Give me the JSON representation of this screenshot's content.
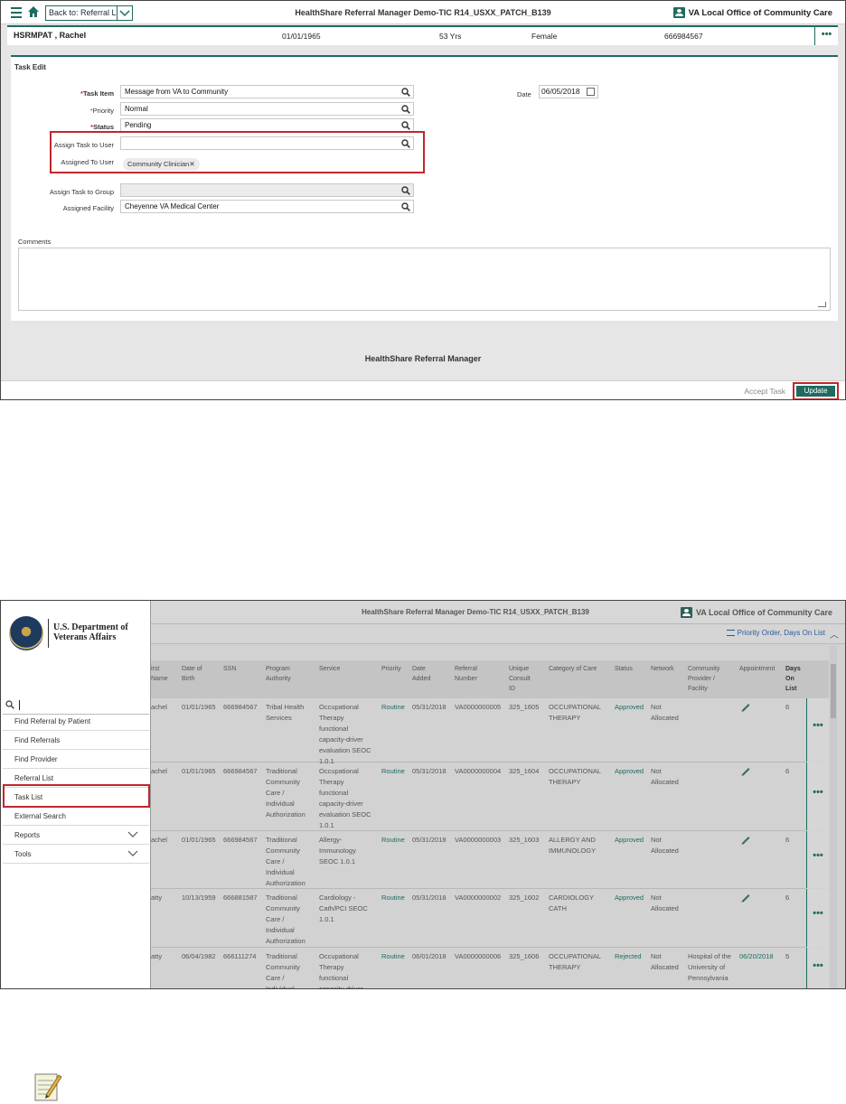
{
  "screen1": {
    "back_label": "Back to: Referral List",
    "app_title": "HealthShare Referral Manager Demo-TIC R14_USXX_PATCH_B139",
    "org_name": "VA Local Office of Community Care",
    "patient": {
      "name": "HSRMPAT , Rachel",
      "dob": "01/01/1965",
      "age": "53 Yrs",
      "gender": "Female",
      "ssn": "666984567"
    },
    "more_label": "•••",
    "form_title": "Task Edit",
    "fields": {
      "task_item": {
        "label": "Task Item",
        "value": "Message from VA to Community"
      },
      "priority": {
        "label": "Priority",
        "value": "Normal"
      },
      "status": {
        "label": "Status",
        "value": "Pending"
      },
      "assign_user": {
        "label": "Assign Task to User",
        "value": ""
      },
      "assigned_to_user": {
        "label": "Assigned To User",
        "chip": "Community Clinician",
        "chip_remove": "✕"
      },
      "assign_group": {
        "label": "Assign Task to Group",
        "value": ""
      },
      "assigned_facility": {
        "label": "Assigned Facility",
        "value": "Cheyenne VA Medical Center"
      },
      "date": {
        "label": "Date",
        "value": "06/05/2018"
      }
    },
    "required_marker": "*",
    "comments_label": "Comments",
    "footer_text": "HealthShare Referral Manager",
    "accept_task_label": "Accept Task",
    "update_label": "Update",
    "highlight_color": "#c0272d",
    "accent_color": "#1e6b5f"
  },
  "link_text": "",
  "screen2": {
    "app_title": "HealthShare Referral Manager Demo-TIC R14_USXX_PATCH_B139",
    "org_name": "VA Local Office of Community Care",
    "sort_label": "Priority Order, Days On List",
    "logo_text_line1": "U.S. Department of",
    "logo_text_line2": "Veterans Affairs",
    "menu": [
      {
        "label": "Find Referral by Patient"
      },
      {
        "label": "Find Referrals"
      },
      {
        "label": "Find Provider"
      },
      {
        "label": "Referral List"
      },
      {
        "label": "Task List"
      },
      {
        "label": "External Search"
      },
      {
        "label": "Reports"
      },
      {
        "label": "Tools"
      }
    ],
    "columns": [
      "irst\nName",
      "Date of\nBirth",
      "SSN",
      "Program\nAuthority",
      "Service",
      "Priority",
      "Date\nAdded",
      "Referral\nNumber",
      "Unique\nConsult\nID",
      "Category of Care",
      "Status",
      "Network",
      "Community\nProvider /\nFacility",
      "Appointment",
      "Days\nOn\nList"
    ],
    "rows": [
      {
        "first": "achel",
        "dob": "01/01/1965",
        "ssn": "666984567",
        "program": "Tribal Health\nServices",
        "service": "Occupational\nTherapy\nfunctional\ncapacity-driver\nevaluation SEOC\n1.0.1",
        "priority": "Routine",
        "added": "05/31/2018",
        "referral": "VA0000000005",
        "consult": "325_1605",
        "category": "OCCUPATIONAL\nTHERAPY",
        "status": "Approved",
        "network": "Not\nAllocated",
        "provider": "",
        "appointment": "",
        "days": "6"
      },
      {
        "first": "achel",
        "dob": "01/01/1965",
        "ssn": "666984567",
        "program": "Traditional\nCommunity\nCare /\nIndividual\nAuthorization",
        "service": "Occupational\nTherapy\nfunctional\ncapacity-driver\nevaluation SEOC\n1.0.1",
        "priority": "Routine",
        "added": "05/31/2018",
        "referral": "VA0000000004",
        "consult": "325_1604",
        "category": "OCCUPATIONAL\nTHERAPY",
        "status": "Approved",
        "network": "Not\nAllocated",
        "provider": "",
        "appointment": "",
        "days": "6"
      },
      {
        "first": "achel",
        "dob": "01/01/1965",
        "ssn": "666984567",
        "program": "Traditional\nCommunity\nCare /\nIndividual\nAuthorization",
        "service": "Allergy-\nImmunology\nSEOC 1.0.1",
        "priority": "Routine",
        "added": "05/31/2018",
        "referral": "VA0000000003",
        "consult": "325_1603",
        "category": "ALLERGY AND\nIMMUNOLOGY",
        "status": "Approved",
        "network": "Not\nAllocated",
        "provider": "",
        "appointment": "",
        "days": "6"
      },
      {
        "first": "atty",
        "dob": "10/13/1959",
        "ssn": "666881587",
        "program": "Traditional\nCommunity\nCare /\nIndividual\nAuthorization",
        "service": "Cardiology -\nCath/PCI SEOC\n1.0.1",
        "priority": "Routine",
        "added": "05/31/2018",
        "referral": "VA0000000002",
        "consult": "325_1602",
        "category": "CARDIOLOGY\nCATH",
        "status": "Approved",
        "network": "Not\nAllocated",
        "provider": "",
        "appointment": "",
        "days": "6"
      },
      {
        "first": "atty",
        "dob": "06/04/1982",
        "ssn": "666111274",
        "program": "Traditional\nCommunity\nCare /\nIndividual",
        "service": "Occupational\nTherapy\nfunctional\ncapacity-driver",
        "priority": "Routine",
        "added": "06/01/2018",
        "referral": "VA0000000006",
        "consult": "325_1606",
        "category": "OCCUPATIONAL\nTHERAPY",
        "status": "Rejected",
        "network": "Not\nAllocated",
        "provider": "Hospital of the\nUniversity of\nPennsylvania",
        "appointment": "06/20/2018",
        "days": "5"
      }
    ],
    "more_label": "•••"
  }
}
